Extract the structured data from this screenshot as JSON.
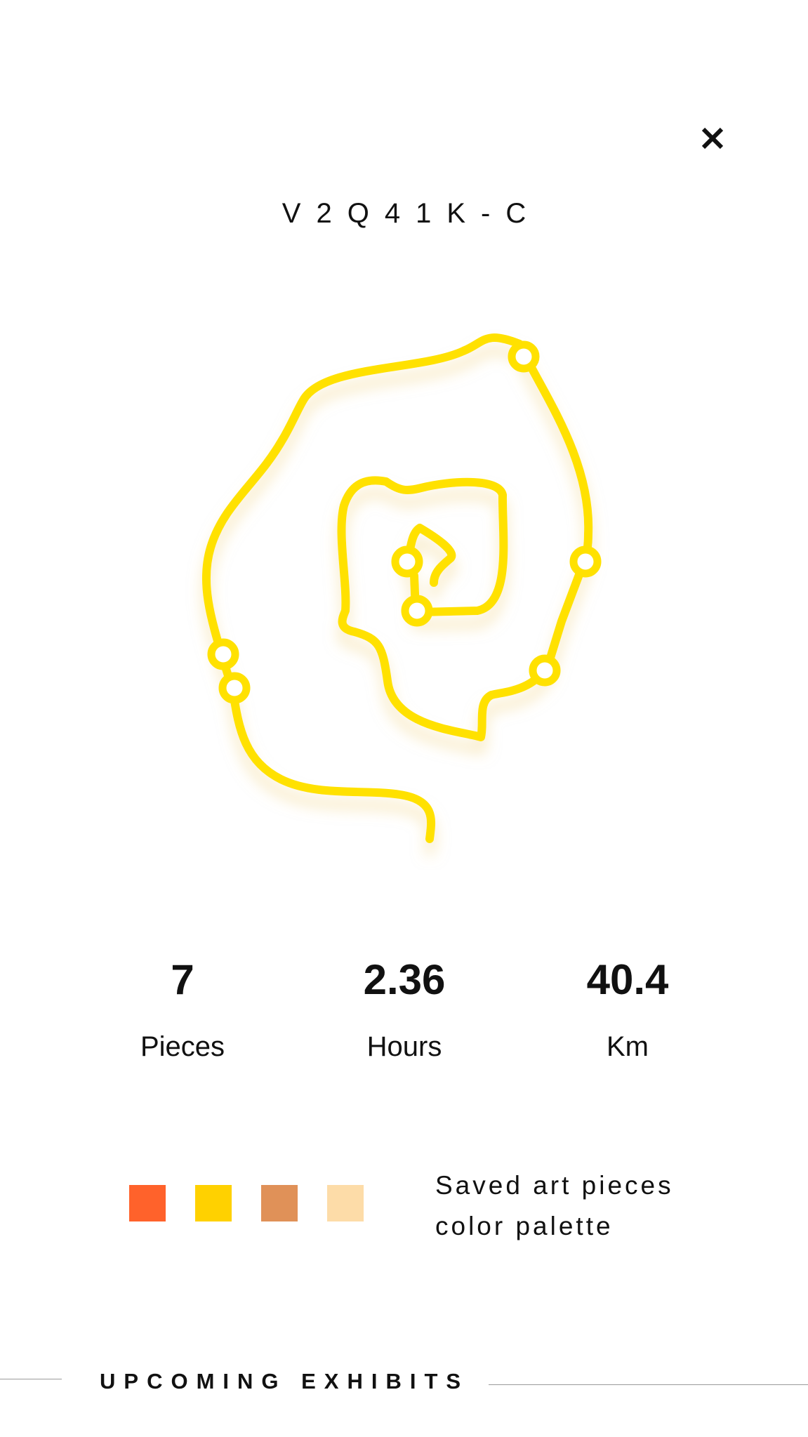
{
  "header": {
    "code": "V2Q41K-C",
    "close_icon": "close-icon"
  },
  "art": {
    "stroke_color": "#FFE100",
    "node_count": 7
  },
  "stats": [
    {
      "value": "7",
      "label": "Pieces"
    },
    {
      "value": "2.36",
      "label": "Hours"
    },
    {
      "value": "40.4",
      "label": "Km"
    }
  ],
  "palette": {
    "colors": [
      "#FF622B",
      "#FFD100",
      "#E09158",
      "#FDDCA8"
    ],
    "caption_line1": "Saved art pieces",
    "caption_line2": "color palette"
  },
  "section": {
    "title": "UPCOMING EXHIBITS"
  }
}
